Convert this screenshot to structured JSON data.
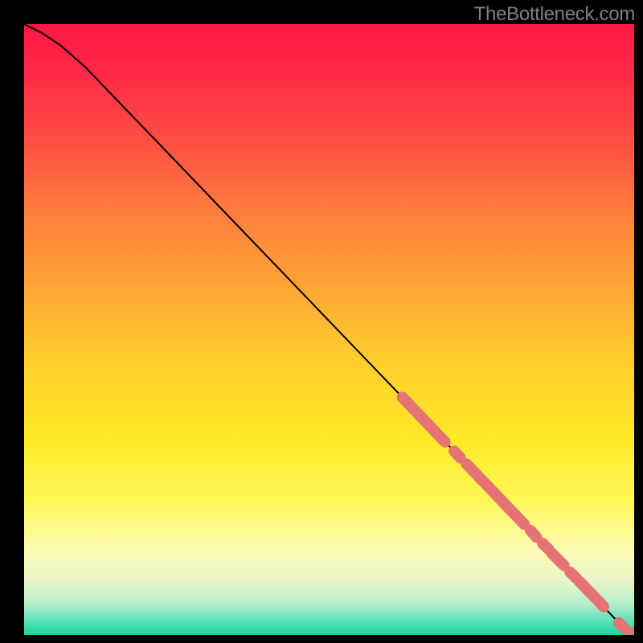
{
  "attribution": "TheBottleneck.com",
  "chart_data": {
    "type": "line",
    "title": "",
    "xlabel": "",
    "ylabel": "",
    "xlim": [
      0,
      100
    ],
    "ylim": [
      0,
      100
    ],
    "grid": false,
    "legend": false,
    "background_gradient": {
      "stops": [
        {
          "offset": 0.0,
          "color": "#ff1745"
        },
        {
          "offset": 0.08,
          "color": "#ff2a47"
        },
        {
          "offset": 0.18,
          "color": "#ff4a44"
        },
        {
          "offset": 0.3,
          "color": "#ff7a3e"
        },
        {
          "offset": 0.42,
          "color": "#ffa236"
        },
        {
          "offset": 0.55,
          "color": "#ffce2c"
        },
        {
          "offset": 0.68,
          "color": "#ffe926"
        },
        {
          "offset": 0.78,
          "color": "#fff85a"
        },
        {
          "offset": 0.86,
          "color": "#fcfbb4"
        },
        {
          "offset": 0.91,
          "color": "#e9f7c6"
        },
        {
          "offset": 0.95,
          "color": "#b6eecb"
        },
        {
          "offset": 0.975,
          "color": "#5fe2bb"
        },
        {
          "offset": 1.0,
          "color": "#1fd39e"
        }
      ]
    },
    "curve": {
      "x": [
        0,
        3,
        6,
        10,
        20,
        30,
        40,
        50,
        60,
        70,
        80,
        88,
        92,
        95,
        97,
        100
      ],
      "y": [
        100,
        98.5,
        96.5,
        93,
        82.6,
        72.2,
        61.8,
        51.4,
        41,
        30.6,
        20.2,
        11.9,
        7.7,
        4.6,
        2.5,
        0.4
      ]
    },
    "marker_clusters": [
      {
        "x_start": 62,
        "x_end": 69,
        "y_start": 38.9,
        "y_end": 31.6
      },
      {
        "x_start": 70.5,
        "x_end": 71.5,
        "y_start": 30.1,
        "y_end": 29.0
      },
      {
        "x_start": 72.5,
        "x_end": 82,
        "y_start": 28.0,
        "y_end": 18.1
      },
      {
        "x_start": 83,
        "x_end": 84,
        "y_start": 17.1,
        "y_end": 16.0
      },
      {
        "x_start": 85,
        "x_end": 86,
        "y_start": 15.0,
        "y_end": 14.0
      },
      {
        "x_start": 86.5,
        "x_end": 88.5,
        "y_start": 13.4,
        "y_end": 11.4
      },
      {
        "x_start": 89.5,
        "x_end": 90.5,
        "y_start": 10.3,
        "y_end": 9.3
      },
      {
        "x_start": 91,
        "x_end": 93.5,
        "y_start": 8.8,
        "y_end": 6.2
      },
      {
        "x_start": 94,
        "x_end": 95,
        "y_start": 5.7,
        "y_end": 4.6
      },
      {
        "x_start": 97.5,
        "x_end": 98.5,
        "y_start": 2.0,
        "y_end": 1.0
      },
      {
        "x_start": 100,
        "x_end": 101,
        "y_start": 0.4,
        "y_end": 0.4
      }
    ],
    "colors": {
      "curve": "#000000",
      "marker_fill": "#e57373",
      "marker_stroke": "#d66464"
    }
  }
}
